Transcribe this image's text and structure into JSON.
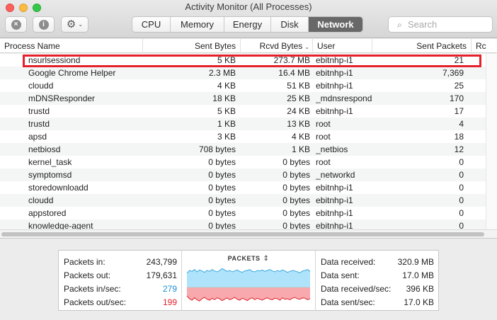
{
  "window": {
    "title": "Activity Monitor (All Processes)"
  },
  "toolbar": {
    "stop_glyph": "×",
    "info_glyph": "i",
    "gear_glyph": "⚙",
    "chevron_glyph": "⌄",
    "tabs": [
      {
        "label": "CPU",
        "active": false
      },
      {
        "label": "Memory",
        "active": false
      },
      {
        "label": "Energy",
        "active": false
      },
      {
        "label": "Disk",
        "active": false
      },
      {
        "label": "Network",
        "active": true
      }
    ],
    "search_placeholder": "Search"
  },
  "table": {
    "columns": [
      "Process Name",
      "Sent Bytes",
      "Rcvd Bytes",
      "User",
      "Sent Packets",
      "Rc"
    ],
    "sort_indicator": "⌄",
    "rows": [
      {
        "name": "nsurlsessiond",
        "sent": "5 KB",
        "rcvd": "273.7 MB",
        "user": "ebitnhp-i1",
        "packets": "21"
      },
      {
        "name": "Google Chrome Helper",
        "sent": "2.3 MB",
        "rcvd": "16.4 MB",
        "user": "ebitnhp-i1",
        "packets": "7,369"
      },
      {
        "name": "cloudd",
        "sent": "4 KB",
        "rcvd": "51 KB",
        "user": "ebitnhp-i1",
        "packets": "25"
      },
      {
        "name": "mDNSResponder",
        "sent": "18 KB",
        "rcvd": "25 KB",
        "user": "_mdnsrespond",
        "packets": "170"
      },
      {
        "name": "trustd",
        "sent": "5 KB",
        "rcvd": "24 KB",
        "user": "ebitnhp-i1",
        "packets": "17"
      },
      {
        "name": "trustd",
        "sent": "1 KB",
        "rcvd": "13 KB",
        "user": "root",
        "packets": "4"
      },
      {
        "name": "apsd",
        "sent": "3 KB",
        "rcvd": "4 KB",
        "user": "root",
        "packets": "18"
      },
      {
        "name": "netbiosd",
        "sent": "708 bytes",
        "rcvd": "1 KB",
        "user": "_netbios",
        "packets": "12"
      },
      {
        "name": "kernel_task",
        "sent": "0 bytes",
        "rcvd": "0 bytes",
        "user": "root",
        "packets": "0"
      },
      {
        "name": "symptomsd",
        "sent": "0 bytes",
        "rcvd": "0 bytes",
        "user": "_networkd",
        "packets": "0"
      },
      {
        "name": "storedownloadd",
        "sent": "0 bytes",
        "rcvd": "0 bytes",
        "user": "ebitnhp-i1",
        "packets": "0"
      },
      {
        "name": "cloudd",
        "sent": "0 bytes",
        "rcvd": "0 bytes",
        "user": "ebitnhp-i1",
        "packets": "0"
      },
      {
        "name": "appstored",
        "sent": "0 bytes",
        "rcvd": "0 bytes",
        "user": "ebitnhp-i1",
        "packets": "0"
      },
      {
        "name": "knowledge-agent",
        "sent": "0 bytes",
        "rcvd": "0 bytes",
        "user": "ebitnhp-i1",
        "packets": "0"
      }
    ]
  },
  "summary": {
    "left": [
      {
        "label": "Packets in:",
        "value": "243,799",
        "color": ""
      },
      {
        "label": "Packets out:",
        "value": "179,631",
        "color": ""
      },
      {
        "label": "Packets in/sec:",
        "value": "279",
        "color": "blue"
      },
      {
        "label": "Packets out/sec:",
        "value": "199",
        "color": "red"
      }
    ],
    "graph_title": "PACKETS",
    "graph_toggle_glyph": "⇕",
    "right": [
      {
        "label": "Data received:",
        "value": "320.9 MB"
      },
      {
        "label": "Data sent:",
        "value": "17.0 MB"
      },
      {
        "label": "Data received/sec:",
        "value": "396 KB"
      },
      {
        "label": "Data sent/sec:",
        "value": "17.0 KB"
      }
    ]
  },
  "colors": {
    "in_fill": "#aee3fb",
    "in_line": "#3aa7e0",
    "out_fill": "#f8a9ad",
    "out_line": "#e0222a",
    "highlight": "#e5202d"
  },
  "graph_series": {
    "packets_in": [
      30,
      36,
      34,
      38,
      33,
      37,
      35,
      32,
      36,
      34,
      38,
      35,
      33,
      36,
      40,
      37,
      34,
      36,
      33,
      35,
      37,
      34,
      32,
      35,
      36,
      38,
      34,
      33,
      36,
      35,
      37,
      34,
      36,
      38,
      35,
      33,
      36,
      34,
      37,
      35,
      32,
      34,
      36,
      35,
      33,
      31,
      35,
      36,
      38,
      34
    ],
    "packets_out": [
      18,
      24,
      27,
      22,
      26,
      29,
      24,
      21,
      25,
      27,
      23,
      26,
      22,
      24,
      28,
      25,
      22,
      26,
      24,
      21,
      25,
      27,
      23,
      25,
      28,
      24,
      22,
      26,
      23,
      25,
      27,
      24,
      22,
      25,
      26,
      23,
      24,
      27,
      22,
      25,
      24,
      26,
      23,
      21,
      24,
      25,
      22,
      23,
      26,
      24
    ]
  },
  "icons": {
    "search": "search-icon",
    "gear": "gear-icon",
    "stop": "stop-process-icon",
    "info": "info-icon"
  }
}
